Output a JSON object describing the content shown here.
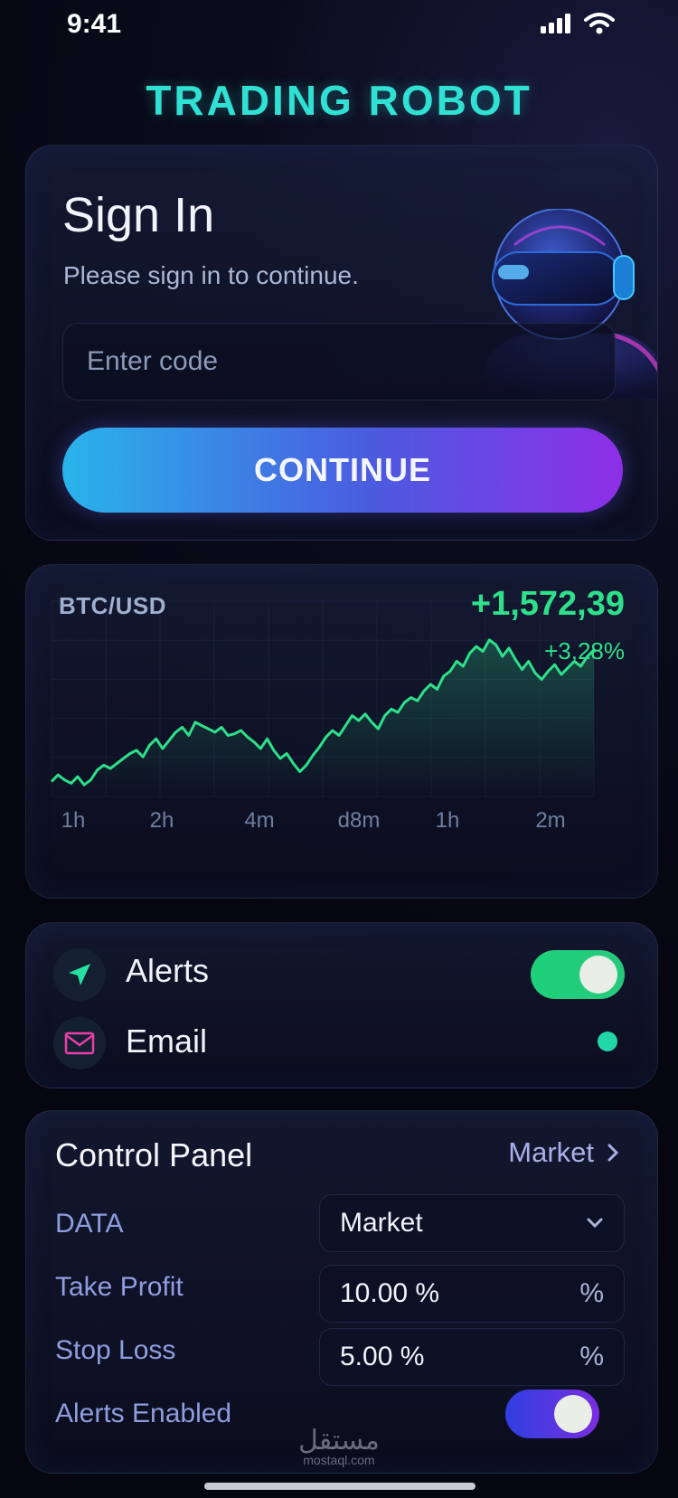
{
  "status_bar": {
    "time": "9:41",
    "icons": [
      "signal-icon",
      "wifi-icon"
    ]
  },
  "app": {
    "title": "TRADING ROBOT"
  },
  "signin": {
    "title": "Sign In",
    "subtitle": "Please sign in to continue.",
    "code_placeholder": "Enter code",
    "code_value": "",
    "continue_label": "CONTINUE"
  },
  "ticker": {
    "pair": "BTC/USD",
    "price": "+1,572,39",
    "change_pct": "+3,28%"
  },
  "chart_data": {
    "type": "line",
    "x_tick_labels": [
      "1h",
      "2h",
      "4m",
      "d8m",
      "1h",
      "2m"
    ],
    "color": "#2ee08a",
    "series": [
      {
        "values": [
          30,
          34,
          31,
          29,
          33,
          28,
          31,
          37,
          40,
          38,
          41,
          44,
          47,
          49,
          45,
          52,
          56,
          50,
          55,
          60,
          63,
          58,
          66,
          64,
          62,
          60,
          63,
          58,
          59,
          61,
          57,
          54,
          50,
          56,
          49,
          44,
          47,
          41,
          36,
          40,
          46,
          51,
          57,
          61,
          58,
          64,
          70,
          67,
          71,
          66,
          62,
          70,
          74,
          72,
          78,
          81,
          79,
          85,
          89,
          86,
          94,
          97,
          103,
          100,
          108,
          112,
          109,
          116,
          113,
          106,
          111,
          104,
          98,
          103,
          96,
          92,
          97,
          101,
          95,
          99,
          103,
          100,
          106,
          110
        ]
      }
    ]
  },
  "notifications": {
    "alerts_label": "Alerts",
    "alerts_on": true,
    "email_label": "Email",
    "email_status_color": "#22d6a8"
  },
  "control_panel": {
    "title": "Control Panel",
    "link_label": "Market",
    "data_label": "DATA",
    "data_value": "Market",
    "take_profit_label": "Take Profit",
    "take_profit_value": "10.00 %",
    "take_profit_unit": "%",
    "stop_loss_label": "Stop Loss",
    "stop_loss_value": "5.00 %",
    "stop_loss_unit": "%",
    "alerts_enabled_label": "Alerts Enabled",
    "alerts_enabled_on": true
  },
  "watermark": {
    "arabic": "مستقل",
    "latin": "mostaql.com"
  }
}
